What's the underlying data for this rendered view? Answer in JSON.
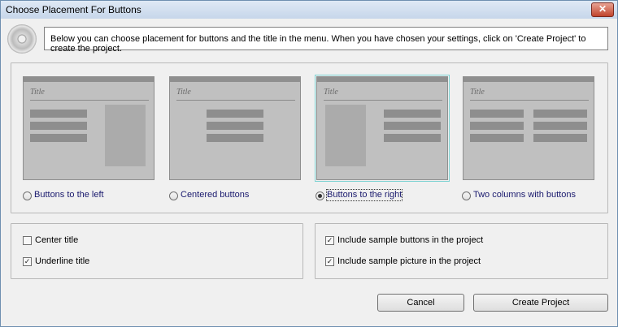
{
  "window": {
    "title": "Choose Placement For Buttons",
    "close_glyph": "✕"
  },
  "info": {
    "text": "Below you can choose placement for buttons and the title in the menu. When you have chosen your settings, click on 'Create Project' to create the project."
  },
  "layouts": [
    {
      "preview_title": "Title",
      "label": "Buttons to the left",
      "selected": false
    },
    {
      "preview_title": "Title",
      "label": "Centered buttons",
      "selected": false
    },
    {
      "preview_title": "Title",
      "label": "Buttons to the right",
      "selected": true
    },
    {
      "preview_title": "Title",
      "label": "Two columns with buttons",
      "selected": false
    }
  ],
  "title_options": [
    {
      "label": "Center title",
      "checked": false
    },
    {
      "label": "Underline title",
      "checked": true
    }
  ],
  "sample_options": [
    {
      "label": "Include sample buttons in the project",
      "checked": true
    },
    {
      "label": "Include sample picture in the project",
      "checked": true
    }
  ],
  "buttons": {
    "cancel": "Cancel",
    "create": "Create Project"
  },
  "icons": {
    "app": "cd-disc-icon",
    "close": "close-icon"
  },
  "colors": {
    "selection_outline": "#7fd3d3",
    "radio_label": "#1a1a6e",
    "close_button": "#c0432c"
  }
}
